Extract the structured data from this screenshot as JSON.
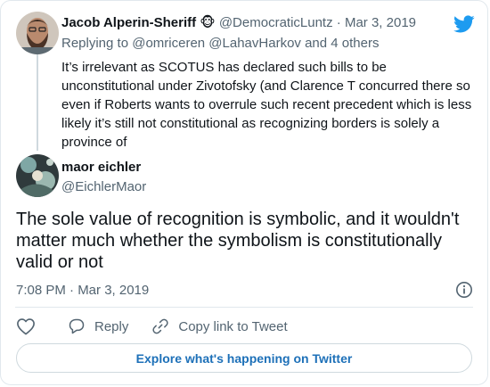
{
  "reply_tweet": {
    "author_name": "Jacob Alperin-Sheriff",
    "author_emoji": "🐵",
    "author_handle": "@DemocraticLuntz",
    "separator": "·",
    "date": "Mar 3, 2019",
    "replying_prefix": "Replying to",
    "replying_to": "@omriceren @LahavHarkov and 4 others",
    "text": "It’s irrelevant as SCOTUS has declared such bills to be unconstitutional under Zivotofsky (and Clarence T concurred there so even if Roberts wants to overrule such recent precedent which is less likely it’s still not constitutional as recognizing borders is solely a province of"
  },
  "main_tweet": {
    "author_name": "maor eichler",
    "author_handle": "@EichlerMaor",
    "text": "The sole value of recognition is symbolic, and it wouldn't matter much whether the symbolism is constitutionally valid or not",
    "timestamp": "7:08 PM · Mar 3, 2019"
  },
  "actions": {
    "like_icon": "heart-icon",
    "reply_label": "Reply",
    "copy_link_label": "Copy link to Tweet"
  },
  "explore_label": "Explore what's happening on Twitter",
  "colors": {
    "twitter_blue": "#1d9bf0",
    "link_blue": "#1d70b8",
    "muted_text": "#536471",
    "border": "#e1e8ed"
  }
}
